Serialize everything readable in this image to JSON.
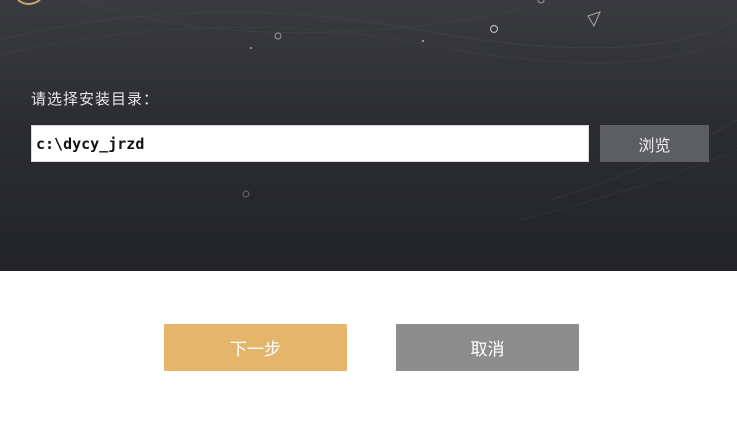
{
  "install_dir": {
    "label": "请选择安装目录：",
    "path_value": "c:\\dycy_jrzd",
    "browse_label": "浏览"
  },
  "footer": {
    "next_label": "下一步",
    "cancel_label": "取消"
  },
  "colors": {
    "panel_dark": "#2c2d31",
    "browse_bg": "#5d5e62",
    "next_bg": "#e4b56b",
    "cancel_bg": "#8d8d8d"
  }
}
